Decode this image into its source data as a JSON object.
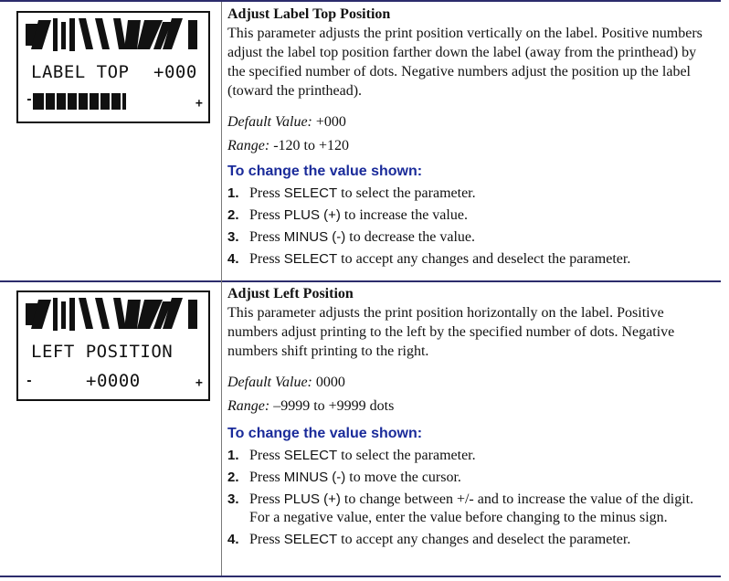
{
  "colors": {
    "rule": "#2c2c6c",
    "subhead": "#1a2b9a",
    "divider": "#7a7a7a"
  },
  "section1": {
    "lcd": {
      "line1": "LABEL TOP",
      "value": "+000",
      "minus": "-",
      "plus": "+",
      "bar_level": 0.6
    },
    "title": "Adjust Label Top Position",
    "description": "This parameter adjusts the print position vertically on the label. Positive numbers adjust the label top position farther down the label (away from the printhead) by the specified number of dots. Negative numbers adjust the position up the label (toward the printhead).",
    "default_label": "Default Value:",
    "default_value": "+000",
    "range_label": "Range:",
    "range_value": "-120 to +120",
    "subhead": "To change the value shown:",
    "steps": [
      {
        "num": "1.",
        "pre": "Press ",
        "key": "SELECT",
        "post": " to select the parameter."
      },
      {
        "num": "2.",
        "pre": "Press ",
        "key": "PLUS (+)",
        "post": " to increase the value."
      },
      {
        "num": "3.",
        "pre": "Press ",
        "key": "MINUS (-)",
        "post": " to decrease the value."
      },
      {
        "num": "4.",
        "pre": "Press ",
        "key": "SELECT",
        "post": " to accept any changes and deselect the parameter."
      }
    ]
  },
  "section2": {
    "lcd": {
      "line1": "LEFT POSITION",
      "minus": "-",
      "value": "+0000",
      "plus": "+"
    },
    "title": "Adjust Left Position",
    "description": "This parameter adjusts the print position horizontally on the label. Positive numbers adjust printing to the left by the specified number of dots. Negative numbers shift printing to the right.",
    "default_label": "Default Value:",
    "default_value": "0000",
    "range_label": "Range:",
    "range_value": "–9999 to +9999 dots",
    "subhead": "To change the value shown:",
    "steps": [
      {
        "num": "1.",
        "pre": "Press ",
        "key": "SELECT",
        "post": " to select the parameter."
      },
      {
        "num": "2.",
        "pre": "Press ",
        "key": "MINUS (-)",
        "post": " to move the cursor."
      },
      {
        "num": "3.",
        "pre": "Press ",
        "key": "PLUS (+)",
        "post": " to change between +/- and to increase the value of the digit. For a negative value, enter the value before changing to the minus sign."
      },
      {
        "num": "4.",
        "pre": "Press ",
        "key": "SELECT",
        "post": " to accept any changes and deselect the parameter."
      }
    ]
  }
}
